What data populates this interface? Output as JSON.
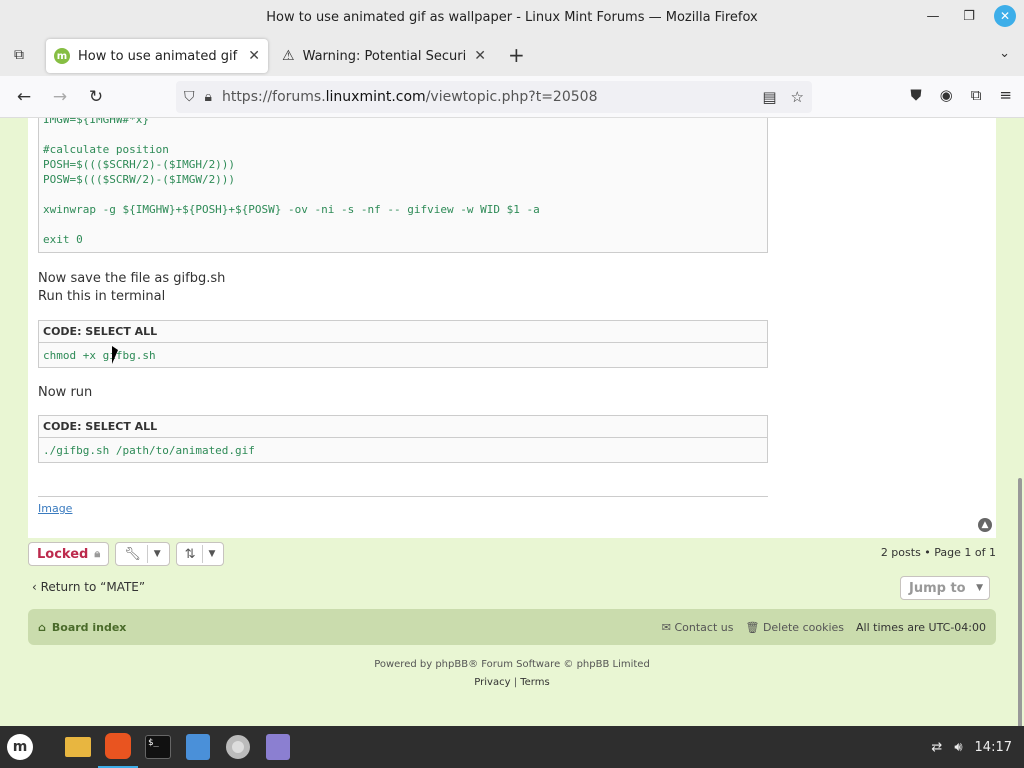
{
  "window": {
    "title": "How to use animated gif as wallpaper - Linux Mint Forums — Mozilla Firefox"
  },
  "tabs": [
    {
      "label": "How to use animated gif as",
      "active": true
    },
    {
      "label": "Warning: Potential Security",
      "active": false
    }
  ],
  "url": {
    "prefix": "https://forums.",
    "domain": "linuxmint.com",
    "path": "/viewtopic.php?t=20508"
  },
  "code1": {
    "lines": [
      "IMGW=${IMGHW#*x}",
      "",
      "#calculate position",
      "POSH=$((($SCRH/2)-($IMGH/2)))",
      "POSW=$((($SCRW/2)-($IMGW/2)))",
      "",
      "xwinwrap -g ${IMGHW}+${POSH}+${POSW} -ov -ni -s -nf -- gifview -w WID $1 -a",
      "",
      "exit 0"
    ]
  },
  "post": {
    "save_text": "Now save the file as gifbg.sh",
    "run_terminal_text": "Run this in terminal",
    "now_run_text": "Now run",
    "code_header": "CODE: SELECT ALL",
    "code2": "chmod +x gifbg.sh",
    "code3": "./gifbg.sh /path/to/animated.gif",
    "signature_link": "Image"
  },
  "actions": {
    "locked_label": "Locked",
    "pagination": "2 posts • Page 1 of 1",
    "return_label": "Return to “MATE”",
    "jump_to_label": "Jump to"
  },
  "bottom_nav": {
    "board_index": "Board index",
    "contact_us": "Contact us",
    "delete_cookies": "Delete cookies",
    "timezone": "All times are UTC-04:00"
  },
  "footer": {
    "powered_by": "Powered by phpBB® Forum Software © phpBB Limited",
    "privacy": "Privacy",
    "separator": "|",
    "terms": "Terms"
  },
  "taskbar": {
    "clock": "14:17"
  }
}
